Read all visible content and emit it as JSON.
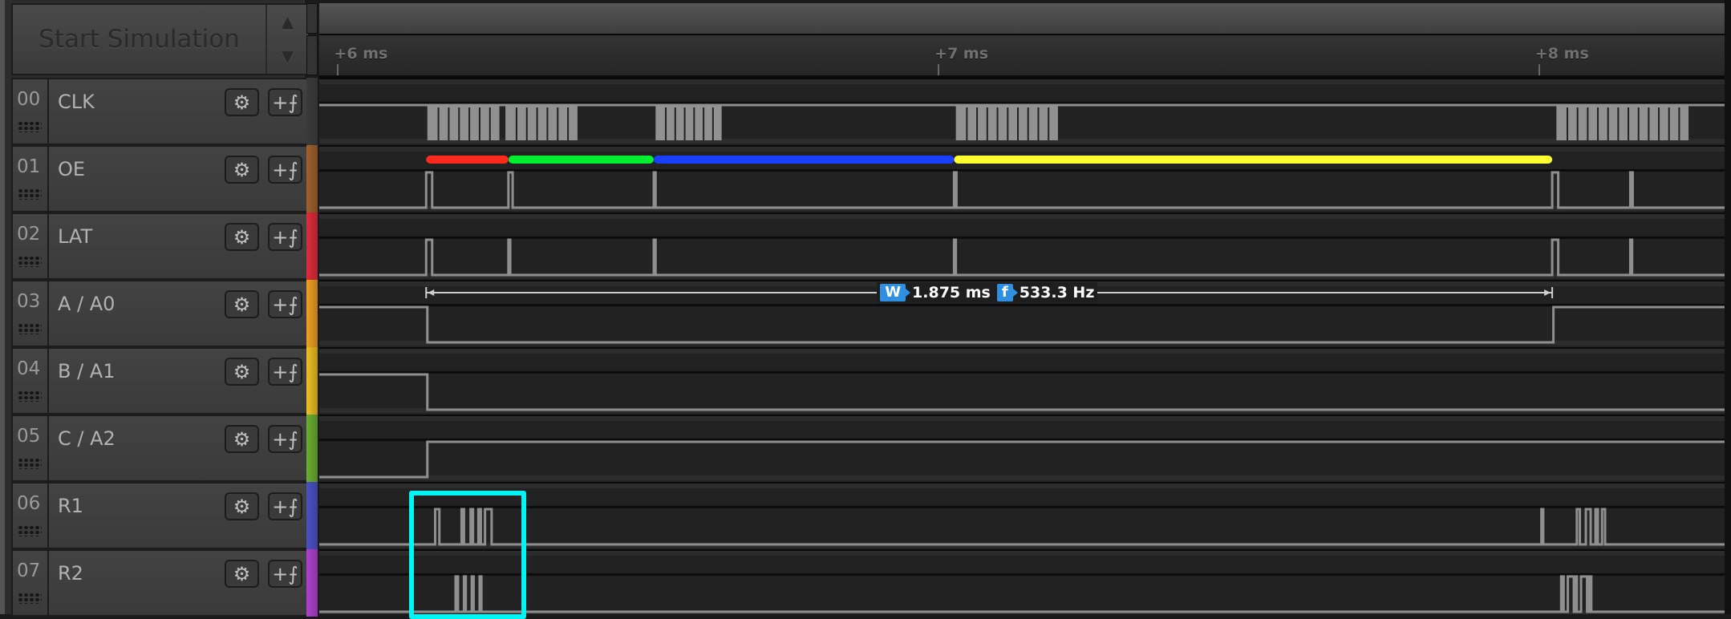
{
  "simulation": {
    "button_label": "Start Simulation",
    "spin_up_icon": "▲",
    "spin_down_icon": "▼"
  },
  "timeline": {
    "ticks": [
      {
        "label": "+6 ms",
        "ms": 6
      },
      {
        "label": "+7 ms",
        "ms": 7
      },
      {
        "label": "+8 ms",
        "ms": 8
      }
    ],
    "view_start_ms": 5.97,
    "view_end_ms": 8.31
  },
  "channels": [
    {
      "num": "00",
      "name": "CLK",
      "color": "#3a3a3a"
    },
    {
      "num": "01",
      "name": "OE",
      "color": "#a0602a"
    },
    {
      "num": "02",
      "name": "LAT",
      "color": "#e02a3a"
    },
    {
      "num": "03",
      "name": "A / A0",
      "color": "#f0a020"
    },
    {
      "num": "04",
      "name": "B / A1",
      "color": "#f0c020"
    },
    {
      "num": "05",
      "name": "C / A2",
      "color": "#6ab030"
    },
    {
      "num": "06",
      "name": "R1",
      "color": "#4a50c8"
    },
    {
      "num": "07",
      "name": "R2",
      "color": "#b040d0"
    }
  ],
  "icons": {
    "gear": "⚙",
    "trigger": "+⨍"
  },
  "measurement": {
    "width_badge": "W",
    "width_value": "1.875 ms",
    "freq_badge": "f",
    "freq_value": "533.3 Hz",
    "start_ms": 6.148,
    "end_ms": 8.023
  },
  "annotations": {
    "oe_segments": [
      {
        "color": "#ff2a1e",
        "start_ms": 6.148,
        "end_ms": 6.285
      },
      {
        "color": "#00f030",
        "start_ms": 6.285,
        "end_ms": 6.527
      },
      {
        "color": "#1a40ff",
        "start_ms": 6.527,
        "end_ms": 7.027
      },
      {
        "color": "#ffff30",
        "start_ms": 7.027,
        "end_ms": 8.023
      }
    ],
    "highlight_box": {
      "color": "#00f4f4",
      "channels": [
        "R1",
        "R2"
      ]
    }
  },
  "waveforms": {
    "CLK": {
      "idle": "high",
      "bursts_ms": [
        [
          6.15,
          6.27
        ],
        [
          6.28,
          6.4
        ],
        [
          6.53,
          6.64
        ],
        [
          7.03,
          7.2
        ],
        [
          8.03,
          8.25
        ]
      ]
    },
    "OE": {
      "idle": "low",
      "pulses_ms": [
        [
          6.148,
          6.158
        ],
        [
          6.285,
          6.292
        ],
        [
          6.527,
          6.53
        ],
        [
          7.027,
          7.031
        ],
        [
          8.023,
          8.033
        ],
        [
          8.153,
          8.157
        ]
      ]
    },
    "LAT": {
      "idle": "low",
      "pulses_ms": [
        [
          6.148,
          6.158
        ],
        [
          6.285,
          6.288
        ],
        [
          6.527,
          6.53
        ],
        [
          7.027,
          7.03
        ],
        [
          8.023,
          8.033
        ],
        [
          8.153,
          8.156
        ]
      ]
    },
    "A / A0": {
      "steps": [
        {
          "ms": 5.97,
          "level": "high"
        },
        {
          "ms": 6.15,
          "level": "low"
        },
        {
          "ms": 8.025,
          "level": "high"
        }
      ]
    },
    "B / A1": {
      "steps": [
        {
          "ms": 5.97,
          "level": "high"
        },
        {
          "ms": 6.15,
          "level": "low"
        }
      ]
    },
    "C / A2": {
      "steps": [
        {
          "ms": 5.97,
          "level": "low"
        },
        {
          "ms": 6.15,
          "level": "high"
        }
      ]
    },
    "R1": {
      "idle": "low",
      "pulses_ms": [
        [
          6.163,
          6.17
        ],
        [
          6.207,
          6.211
        ],
        [
          6.222,
          6.226
        ],
        [
          6.235,
          6.239
        ],
        [
          6.246,
          6.257
        ],
        [
          8.005,
          8.008
        ],
        [
          8.064,
          8.069
        ],
        [
          8.079,
          8.087
        ],
        [
          8.095,
          8.099
        ],
        [
          8.106,
          8.111
        ]
      ]
    },
    "R2": {
      "idle": "low",
      "pulses_ms": [
        [
          6.197,
          6.201
        ],
        [
          6.211,
          6.214
        ],
        [
          6.224,
          6.227
        ],
        [
          6.237,
          6.24
        ],
        [
          8.038,
          8.042
        ],
        [
          8.049,
          8.059
        ],
        [
          8.06,
          8.064
        ],
        [
          8.071,
          8.081
        ],
        [
          8.084,
          8.088
        ]
      ]
    }
  }
}
